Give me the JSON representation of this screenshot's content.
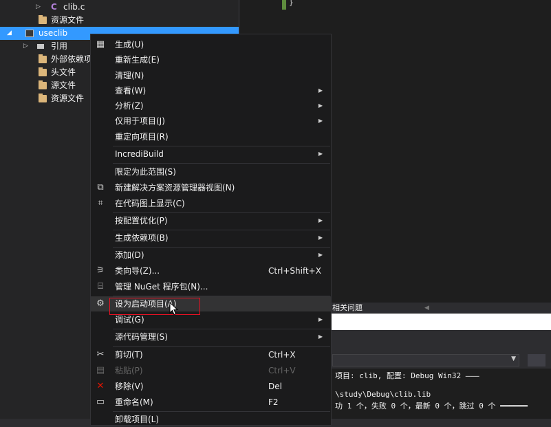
{
  "solution_explorer": {
    "items": [
      {
        "label": "clib.c",
        "icon": "c-file-icon"
      },
      {
        "label": "资源文件",
        "icon": "folder-icon"
      },
      {
        "label": "useclib",
        "icon": "project-icon"
      },
      {
        "label": "引用",
        "icon": "references-icon"
      },
      {
        "label": "外部依赖项",
        "icon": "folder-icon"
      },
      {
        "label": "头文件",
        "icon": "folder-icon"
      },
      {
        "label": "源文件",
        "icon": "folder-icon"
      },
      {
        "label": "资源文件",
        "icon": "folder-icon"
      }
    ],
    "c_glyph": "C"
  },
  "editor": {
    "brace": "}"
  },
  "panel": {
    "tab_label": "相关问题"
  },
  "output": {
    "lines": [
      "项目: clib, 配置: Debug Win32 ———",
      "\\study\\Debug\\clib.lib",
      "功 1 个，失败 0 个，最新 0 个，跳过 0 个 ══════"
    ]
  },
  "context_menu": {
    "items": [
      {
        "label": "生成(U)",
        "icon": "build-icon"
      },
      {
        "label": "重新生成(E)"
      },
      {
        "label": "清理(N)"
      },
      {
        "label": "查看(W)",
        "submenu": true
      },
      {
        "label": "分析(Z)",
        "submenu": true
      },
      {
        "label": "仅用于项目(J)",
        "submenu": true
      },
      {
        "label": "重定向项目(R)"
      },
      {
        "label": "IncrediBuild",
        "submenu": true
      },
      {
        "label": "限定为此范围(S)"
      },
      {
        "label": "新建解决方案资源管理器视图(N)",
        "icon": "new-view-icon"
      },
      {
        "label": "在代码图上显示(C)",
        "icon": "code-map-icon"
      },
      {
        "label": "按配置优化(P)",
        "submenu": true
      },
      {
        "label": "生成依赖项(B)",
        "submenu": true
      },
      {
        "label": "添加(D)",
        "submenu": true
      },
      {
        "label": "类向导(Z)...",
        "shortcut": "Ctrl+Shift+X",
        "icon": "class-wizard-icon"
      },
      {
        "label": "管理 NuGet 程序包(N)...",
        "icon": "nuget-icon"
      },
      {
        "label": "设为启动项目(A)",
        "icon": "gear-icon"
      },
      {
        "label": "调试(G)",
        "submenu": true
      },
      {
        "label": "源代码管理(S)",
        "submenu": true
      },
      {
        "label": "剪切(T)",
        "shortcut": "Ctrl+X",
        "icon": "scissors-icon"
      },
      {
        "label": "粘贴(P)",
        "shortcut": "Ctrl+V",
        "icon": "paste-icon",
        "disabled": true
      },
      {
        "label": "移除(V)",
        "shortcut": "Del",
        "icon": "remove-icon"
      },
      {
        "label": "重命名(M)",
        "shortcut": "F2",
        "icon": "rename-icon"
      },
      {
        "label": "卸载项目(L)"
      }
    ],
    "submenu_glyph": "▶",
    "hover_item": "设为启动项目(A)",
    "colors": {
      "remove_icon": "#e51400",
      "selection": "#3399ff",
      "highlight_box": "#e81123"
    }
  }
}
